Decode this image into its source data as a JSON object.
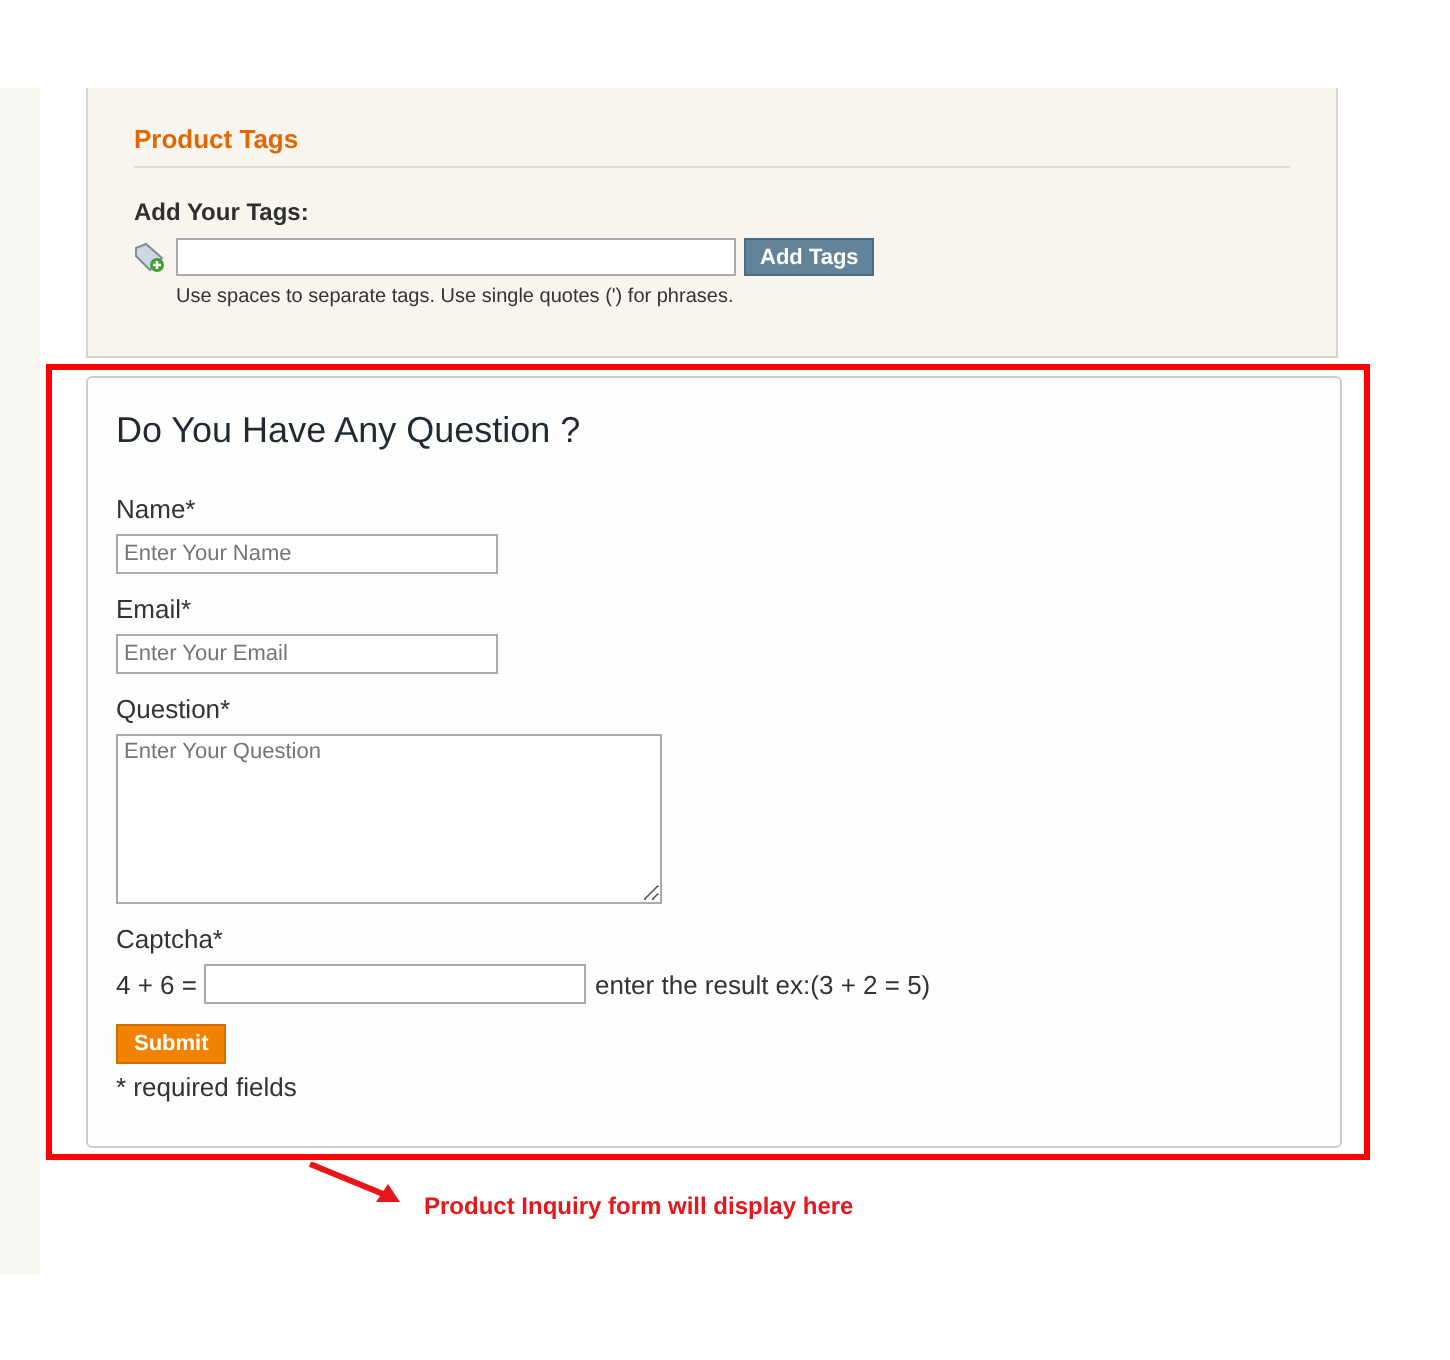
{
  "tags_panel": {
    "title": "Product Tags",
    "label": "Add Your Tags:",
    "button": "Add Tags",
    "hint": "Use spaces to separate tags. Use single quotes (') for phrases."
  },
  "inquiry_form": {
    "title": "Do You Have Any Question ?",
    "fields": [
      {
        "kind": "input",
        "label": "Name*",
        "placeholder": "Enter Your Name"
      },
      {
        "kind": "input",
        "label": "Email*",
        "placeholder": "Enter Your Email"
      },
      {
        "kind": "textarea",
        "label": "Question*",
        "placeholder": "Enter Your Question"
      }
    ],
    "captcha": {
      "label": "Captcha*",
      "question": "4 + 6 =",
      "hint": "enter the result ex:(3 + 2 = 5)"
    },
    "submit": "Submit",
    "required_note": "* required fields"
  },
  "annotation": "Product Inquiry form will display here"
}
